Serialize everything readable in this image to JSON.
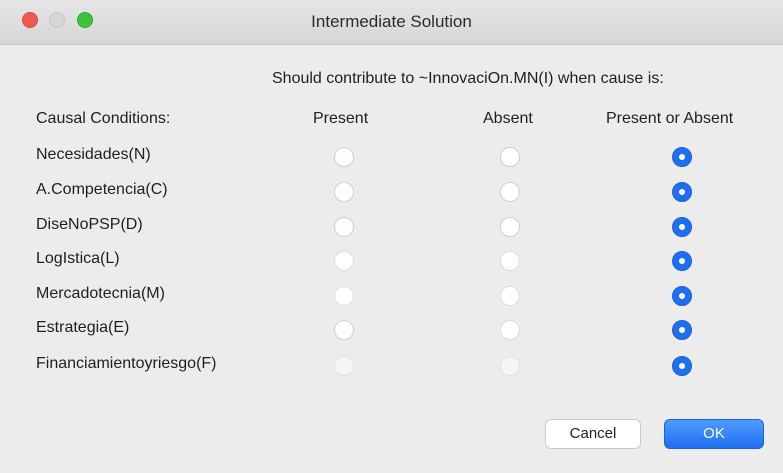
{
  "window": {
    "title": "Intermediate Solution"
  },
  "heading": "Should contribute to ~InnovaciOn.MN(I) when cause is:",
  "columns": {
    "conditions": "Causal Conditions:",
    "present": "Present",
    "absent": "Absent",
    "either": "Present or Absent"
  },
  "rows": [
    {
      "label": "Necesidades(N)",
      "selected": "either"
    },
    {
      "label": "A.Competencia(C)",
      "selected": "either"
    },
    {
      "label": "DiseNoPSP(D)",
      "selected": "either"
    },
    {
      "label": "LogIstica(L)",
      "selected": "either"
    },
    {
      "label": "Mercadotecnia(M)",
      "selected": "either"
    },
    {
      "label": "Estrategia(E)",
      "selected": "either"
    },
    {
      "label": "Financiamientoyriesgo(F)",
      "selected": "either"
    }
  ],
  "buttons": {
    "cancel": "Cancel",
    "ok": "OK"
  },
  "colors": {
    "accent": "#1e6ff0",
    "close": "#ee5a52",
    "zoom": "#3ec33e"
  }
}
